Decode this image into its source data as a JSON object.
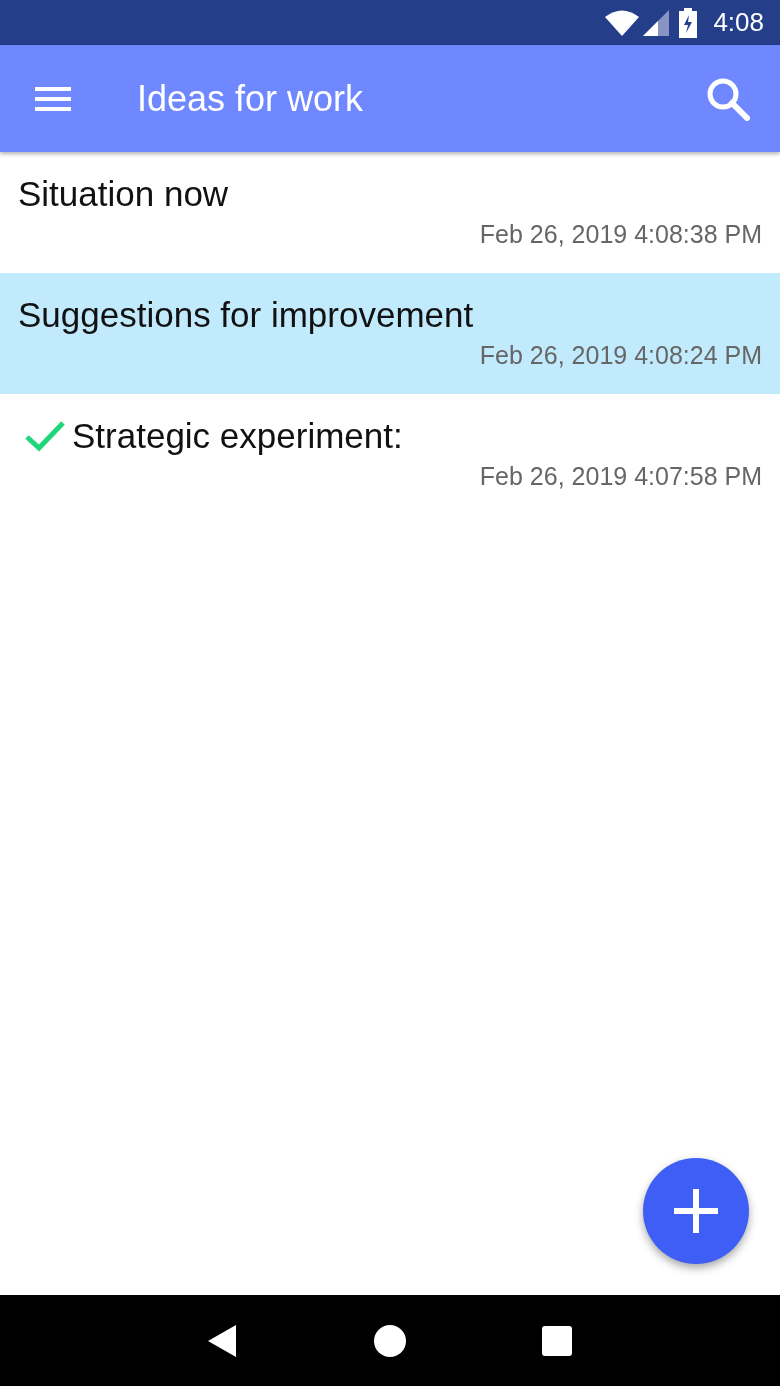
{
  "status_bar": {
    "time": "4:08"
  },
  "app_bar": {
    "title": "Ideas for work"
  },
  "notes": [
    {
      "title": "Situation now",
      "date": "Feb 26, 2019 4:08:38 PM",
      "selected": false,
      "done": false
    },
    {
      "title": "Suggestions for improvement",
      "date": "Feb 26, 2019 4:08:24 PM",
      "selected": true,
      "done": false
    },
    {
      "title": "Strategic experiment:",
      "date": "Feb 26, 2019 4:07:58 PM",
      "selected": false,
      "done": true
    }
  ]
}
